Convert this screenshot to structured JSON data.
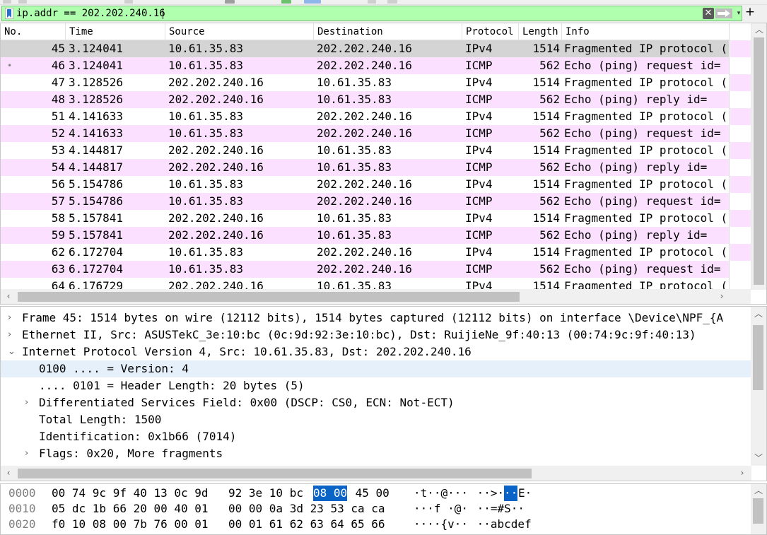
{
  "filter": {
    "value": "ip.addr == 202.202.240.16",
    "clear_glyph": "✕",
    "dropdown_glyph": "▾",
    "add_glyph": "+"
  },
  "colors": {
    "filter_valid_bg": "#afffaf",
    "icmp_row_bg": "#fce0ff",
    "selected_row_bg": "#d4d4d4",
    "bytes_selection": "#0a64c8",
    "detail_highlight": "#e6f0fa"
  },
  "packet_list": {
    "columns": [
      "No.",
      "Time",
      "Source",
      "Destination",
      "Protocol",
      "Length",
      "Info"
    ],
    "rows": [
      {
        "no": "45",
        "time": "3.124041",
        "src": "10.61.35.83",
        "dst": "202.202.240.16",
        "proto": "IPv4",
        "len": "1514",
        "info": "Fragmented IP protocol (",
        "selected": true
      },
      {
        "no": "46",
        "time": "3.124041",
        "src": "10.61.35.83",
        "dst": "202.202.240.16",
        "proto": "ICMP",
        "len": "562",
        "info": "Echo (ping) request  id=",
        "marker": "•"
      },
      {
        "no": "47",
        "time": "3.128526",
        "src": "202.202.240.16",
        "dst": "10.61.35.83",
        "proto": "IPv4",
        "len": "1514",
        "info": "Fragmented IP protocol ("
      },
      {
        "no": "48",
        "time": "3.128526",
        "src": "202.202.240.16",
        "dst": "10.61.35.83",
        "proto": "ICMP",
        "len": "562",
        "info": "Echo (ping) reply    id="
      },
      {
        "no": "51",
        "time": "4.141633",
        "src": "10.61.35.83",
        "dst": "202.202.240.16",
        "proto": "IPv4",
        "len": "1514",
        "info": "Fragmented IP protocol ("
      },
      {
        "no": "52",
        "time": "4.141633",
        "src": "10.61.35.83",
        "dst": "202.202.240.16",
        "proto": "ICMP",
        "len": "562",
        "info": "Echo (ping) request  id="
      },
      {
        "no": "53",
        "time": "4.144817",
        "src": "202.202.240.16",
        "dst": "10.61.35.83",
        "proto": "IPv4",
        "len": "1514",
        "info": "Fragmented IP protocol ("
      },
      {
        "no": "54",
        "time": "4.144817",
        "src": "202.202.240.16",
        "dst": "10.61.35.83",
        "proto": "ICMP",
        "len": "562",
        "info": "Echo (ping) reply    id="
      },
      {
        "no": "56",
        "time": "5.154786",
        "src": "10.61.35.83",
        "dst": "202.202.240.16",
        "proto": "IPv4",
        "len": "1514",
        "info": "Fragmented IP protocol ("
      },
      {
        "no": "57",
        "time": "5.154786",
        "src": "10.61.35.83",
        "dst": "202.202.240.16",
        "proto": "ICMP",
        "len": "562",
        "info": "Echo (ping) request  id="
      },
      {
        "no": "58",
        "time": "5.157841",
        "src": "202.202.240.16",
        "dst": "10.61.35.83",
        "proto": "IPv4",
        "len": "1514",
        "info": "Fragmented IP protocol ("
      },
      {
        "no": "59",
        "time": "5.157841",
        "src": "202.202.240.16",
        "dst": "10.61.35.83",
        "proto": "ICMP",
        "len": "562",
        "info": "Echo (ping) reply    id="
      },
      {
        "no": "62",
        "time": "6.172704",
        "src": "10.61.35.83",
        "dst": "202.202.240.16",
        "proto": "IPv4",
        "len": "1514",
        "info": "Fragmented IP protocol ("
      },
      {
        "no": "63",
        "time": "6.172704",
        "src": "10.61.35.83",
        "dst": "202.202.240.16",
        "proto": "ICMP",
        "len": "562",
        "info": "Echo (ping) request  id="
      },
      {
        "no": "64",
        "time": "6.176729",
        "src": "202.202.240.16",
        "dst": "10.61.35.83",
        "proto": "IPv4",
        "len": "1514",
        "info": "Fragmented IP protocol ("
      }
    ]
  },
  "details": {
    "lines": [
      {
        "toggle": "›",
        "indent": 0,
        "text": "Frame 45: 1514 bytes on wire (12112 bits), 1514 bytes captured (12112 bits) on interface \\Device\\NPF_{A"
      },
      {
        "toggle": "›",
        "indent": 0,
        "text": "Ethernet II, Src: ASUSTekC_3e:10:bc (0c:9d:92:3e:10:bc), Dst: RuijieNe_9f:40:13 (00:74:9c:9f:40:13)"
      },
      {
        "toggle": "⌄",
        "indent": 0,
        "text": "Internet Protocol Version 4, Src: 10.61.35.83, Dst: 202.202.240.16"
      },
      {
        "toggle": "",
        "indent": 1,
        "text": "0100 .... = Version: 4",
        "highlight": true
      },
      {
        "toggle": "",
        "indent": 1,
        "text": ".... 0101 = Header Length: 20 bytes (5)"
      },
      {
        "toggle": "›",
        "indent": 1,
        "text": "Differentiated Services Field: 0x00 (DSCP: CS0, ECN: Not-ECT)"
      },
      {
        "toggle": "",
        "indent": 1,
        "text": "Total Length: 1500"
      },
      {
        "toggle": "",
        "indent": 1,
        "text": "Identification: 0x1b66 (7014)"
      },
      {
        "toggle": "›",
        "indent": 1,
        "text": "Flags: 0x20, More fragments"
      }
    ]
  },
  "bytes": {
    "lines": [
      {
        "offset": "0000",
        "hex_a": "00 74 9c 9f 40 13 0c 9d",
        "hex_b1": "92 3e 10 bc ",
        "hex_sel": "08 00",
        "hex_b2": " 45 00",
        "ascii_a": "·t··@···",
        "ascii_b1": " ··>·",
        "ascii_sel": "··",
        "ascii_b2": "E·"
      },
      {
        "offset": "0010",
        "hex_a": "05 dc 1b 66 20 00 40 01",
        "hex_b1": "00 00 0a 3d 23 53 ca ca",
        "hex_sel": "",
        "hex_b2": "",
        "ascii_a": "···f ·@·",
        "ascii_b1": " ··=#S··",
        "ascii_sel": "",
        "ascii_b2": ""
      },
      {
        "offset": "0020",
        "hex_a": "f0 10 08 00 7b 76 00 01",
        "hex_b1": "00 01 61 62 63 64 65 66",
        "hex_sel": "",
        "hex_b2": "",
        "ascii_a": "····{v··",
        "ascii_b1": " ··abcdef",
        "ascii_sel": "",
        "ascii_b2": ""
      }
    ]
  }
}
